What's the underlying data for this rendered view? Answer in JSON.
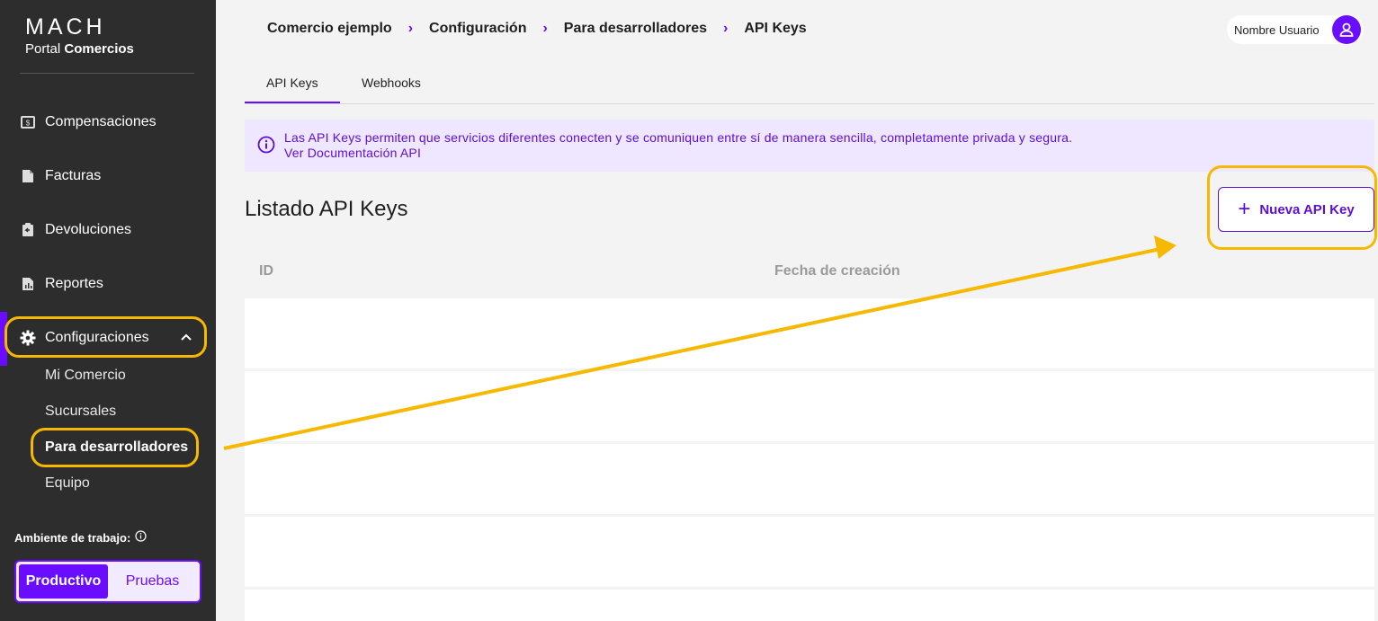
{
  "sidebar": {
    "logo": "MACH",
    "portal_prefix": "Portal",
    "portal_bold": "Comercios",
    "items": [
      {
        "label": "Compensaciones",
        "icon": "money-icon"
      },
      {
        "label": "Facturas",
        "icon": "document-icon"
      },
      {
        "label": "Devoluciones",
        "icon": "clipboard-icon"
      },
      {
        "label": "Reportes",
        "icon": "report-icon"
      },
      {
        "label": "Configuraciones",
        "icon": "gear-icon"
      }
    ],
    "subitems": [
      "Mi Comercio",
      "Sucursales",
      "Para desarrolladores",
      "Equipo"
    ],
    "env_label": "Ambiente de trabajo:",
    "env_options": [
      "Productivo",
      "Pruebas"
    ]
  },
  "header": {
    "breadcrumb": [
      "Comercio ejemplo",
      "Configuración",
      "Para desarrolladores",
      "API Keys"
    ],
    "user_name": "Nombre Usuario"
  },
  "tabs": [
    "API Keys",
    "Webhooks"
  ],
  "info": {
    "line1": "Las API Keys permiten que servicios diferentes conecten y se comuniquen entre sí de manera sencilla, completamente privada y segura.",
    "link": "Ver Documentación API"
  },
  "list": {
    "title": "Listado API Keys",
    "new_button": "Nueva API Key",
    "columns": [
      "ID",
      "Fecha de creación"
    ]
  },
  "colors": {
    "accent": "#6a0dff",
    "highlight": "#f6b800",
    "sidebar_bg": "#2d2d2d"
  }
}
